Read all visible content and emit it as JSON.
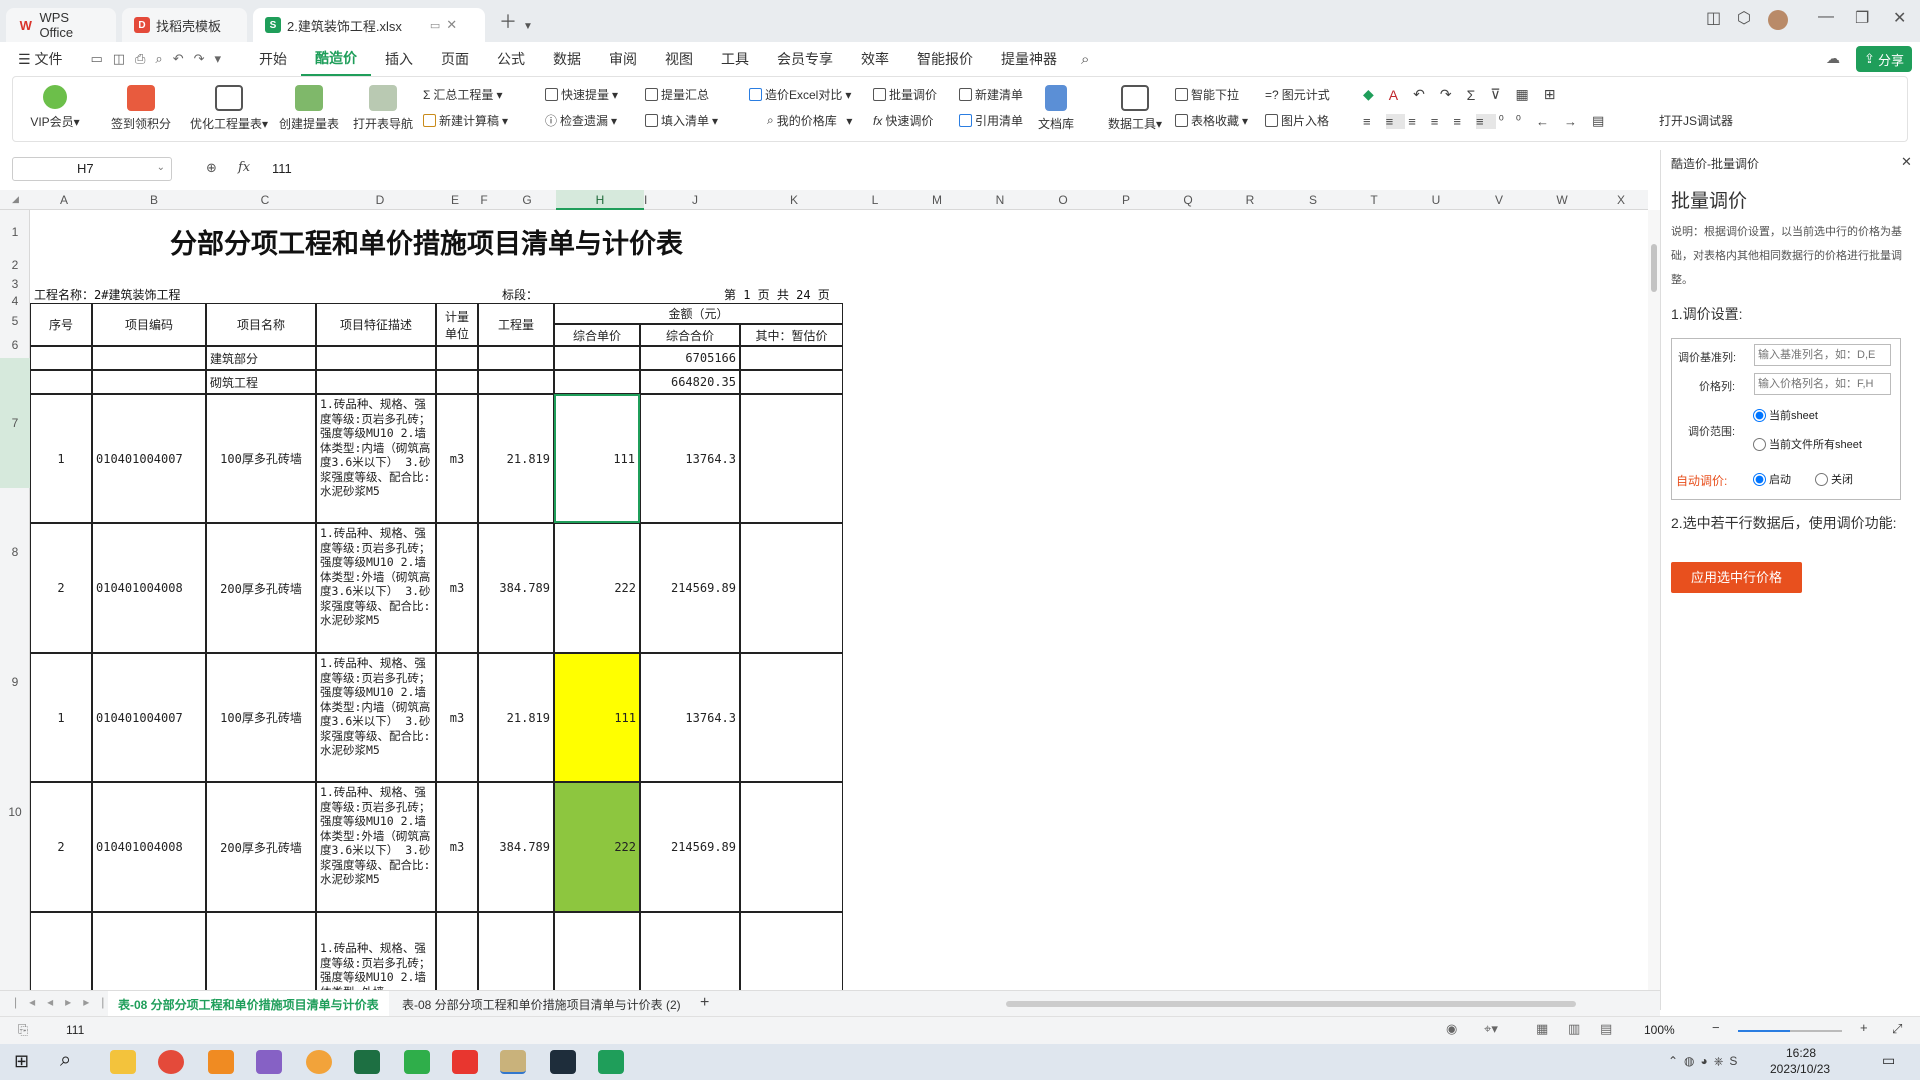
{
  "window": {
    "tabs": [
      {
        "label": "WPS Office"
      },
      {
        "label": "找稻壳模板"
      },
      {
        "label": "2.建筑装饰工程.xlsx"
      }
    ],
    "share_label": "分享"
  },
  "menu": {
    "file": "文件",
    "items": [
      "开始",
      "酷造价",
      "插入",
      "页面",
      "公式",
      "数据",
      "审阅",
      "视图",
      "工具",
      "会员专享",
      "效率",
      "智能报价",
      "提量神器"
    ],
    "active": "酷造价"
  },
  "ribbon": {
    "vip": "VIP会员",
    "sign": "签到领积分",
    "optimize": "优化工程量表",
    "create_extract": "创建提量表",
    "open_nav": "打开表导航",
    "summary_qty": "汇总工程量",
    "new_calc": "新建计算稿",
    "quick_extract": "快速提量",
    "check_missing": "检查遗漏",
    "extract_summary": "提量汇总",
    "fill_list": "填入清单",
    "price_compare": "造价Excel对比",
    "my_price_lib": "我的价格库",
    "batch_adjust": "批量调价",
    "quick_adjust": "快速调价",
    "new_list": "新建清单",
    "ref_list": "引用清单",
    "doc_lib": "文档库",
    "data_tools": "数据工具",
    "smart_dropdown": "智能下拉",
    "table_fav": "表格收藏",
    "yuan_format": "图元计式",
    "image_fit": "图片入格",
    "open_js": "打开JS调试器"
  },
  "formula": {
    "cell_ref": "H7",
    "fx": "fx",
    "value": "111"
  },
  "columns": [
    "A",
    "B",
    "C",
    "D",
    "E",
    "F",
    "G",
    "H",
    "I",
    "J",
    "K",
    "L",
    "M",
    "N",
    "O",
    "P",
    "Q",
    "R",
    "S",
    "T",
    "U",
    "V",
    "W",
    "X"
  ],
  "rows": [
    "1",
    "2",
    "3",
    "4",
    "5",
    "6",
    "7",
    "8",
    "9",
    "10"
  ],
  "sheet": {
    "title": "分部分项工程和单价措施项目清单与计价表",
    "project": "工程名称：2#建筑装饰工程",
    "section": "标段：",
    "page": "第 1 页  共 24 页",
    "headers": {
      "no": "序号",
      "code": "项目编码",
      "name": "项目名称",
      "desc": "项目特征描述",
      "unit": "计量单位",
      "qty": "工程量",
      "amount": "金额（元）",
      "unit_price": "综合单价",
      "total": "综合合价",
      "provisional": "其中：暂估价"
    },
    "sub_rows": [
      {
        "name": "建筑部分",
        "total": "6705166"
      },
      {
        "name": "砌筑工程",
        "total": "664820.35"
      }
    ],
    "items": [
      {
        "no": "1",
        "code": "010401004007",
        "name": "100厚多孔砖墙",
        "desc": "1.砖品种、规格、强度等级:页岩多孔砖；强度等级MU10 2.墙体类型:内墙（砌筑高度3.6米以下） 3.砂浆强度等级、配合比:水泥砂浆M5",
        "unit": "m3",
        "qty": "21.819",
        "price": "111",
        "total": "13764.3"
      },
      {
        "no": "2",
        "code": "010401004008",
        "name": "200厚多孔砖墙",
        "desc": "1.砖品种、规格、强度等级:页岩多孔砖；强度等级MU10 2.墙体类型:外墙（砌筑高度3.6米以下） 3.砂浆强度等级、配合比:水泥砂浆M5",
        "unit": "m3",
        "qty": "384.789",
        "price": "222",
        "total": "214569.89"
      },
      {
        "no": "1",
        "code": "010401004007",
        "name": "100厚多孔砖墙",
        "desc": "1.砖品种、规格、强度等级:页岩多孔砖；强度等级MU10 2.墙体类型:内墙（砌筑高度3.6米以下） 3.砂浆强度等级、配合比:水泥砂浆M5",
        "unit": "m3",
        "qty": "21.819",
        "price": "111",
        "total": "13764.3"
      },
      {
        "no": "2",
        "code": "010401004008",
        "name": "200厚多孔砖墙",
        "desc": "1.砖品种、规格、强度等级:页岩多孔砖；强度等级MU10 2.墙体类型:外墙（砌筑高度3.6米以下） 3.砂浆强度等级、配合比:水泥砂浆M5",
        "unit": "m3",
        "qty": "384.789",
        "price": "222",
        "total": "214569.89"
      }
    ],
    "partial_desc": "1.砖品种、规格、强度等级:页岩多孔砖；强度等级MU10 2.墙体类型:外墙",
    "highlight_colors": {
      "yellow": "#ffff00",
      "green": "#8dc63f",
      "selected": "#1f9e5a"
    }
  },
  "panel": {
    "header": "酷造价-批量调价",
    "title": "批量调价",
    "desc": "说明：根据调价设置，以当前选中行的价格为基础，对表格内其他相同数据行的价格进行批量调整。",
    "section1": "1.调价设置:",
    "base_col_label": "调价基准列:",
    "base_col_placeholder": "输入基准列名，如：D,E",
    "price_col_label": "价格列:",
    "price_col_placeholder": "输入价格列名，如：F,H",
    "scope_label": "调价范围:",
    "scope_opt1": "当前sheet",
    "scope_opt2": "当前文件所有sheet",
    "auto_label": "自动调价:",
    "auto_on": "启动",
    "auto_off": "关闭",
    "section2": "2.选中若干行数据后，使用调价功能:",
    "apply_btn": "应用选中行价格",
    "accent": "#e8501e"
  },
  "sheet_tabs": [
    "表-08 分部分项工程和单价措施项目清单与计价表",
    "表-08 分部分项工程和单价措施项目清单与计价表 (2)"
  ],
  "status": {
    "value": "111",
    "zoom": "100%"
  },
  "taskbar": {
    "time": "16:28",
    "date": "2023/10/23"
  }
}
